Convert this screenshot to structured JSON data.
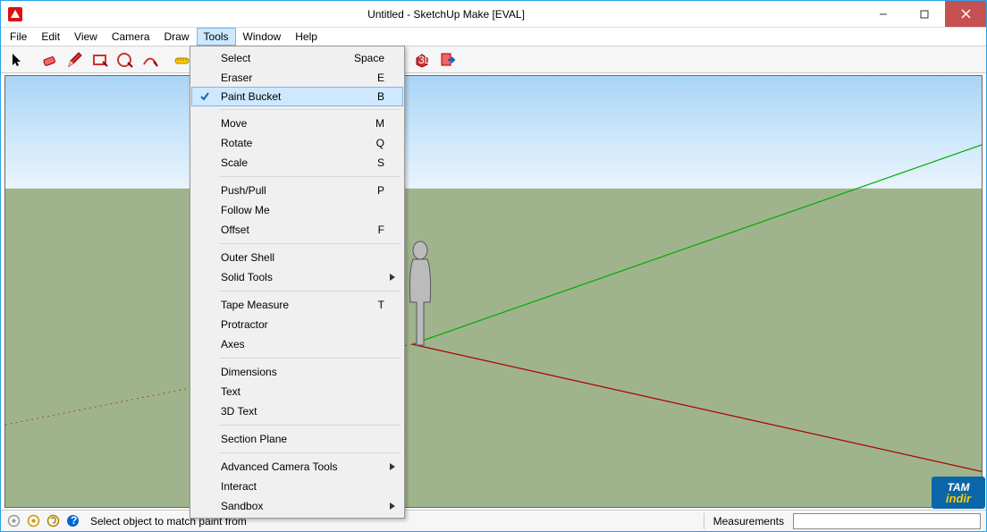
{
  "window": {
    "title": "Untitled - SketchUp Make [EVAL]"
  },
  "menubar": [
    "File",
    "Edit",
    "View",
    "Camera",
    "Draw",
    "Tools",
    "Window",
    "Help"
  ],
  "menubar_open": 5,
  "dropdown": {
    "groups": [
      [
        {
          "label": "Select",
          "shortcut": "Space",
          "checked": false
        },
        {
          "label": "Eraser",
          "shortcut": "E",
          "checked": false
        },
        {
          "label": "Paint Bucket",
          "shortcut": "B",
          "checked": true
        }
      ],
      [
        {
          "label": "Move",
          "shortcut": "M"
        },
        {
          "label": "Rotate",
          "shortcut": "Q"
        },
        {
          "label": "Scale",
          "shortcut": "S"
        }
      ],
      [
        {
          "label": "Push/Pull",
          "shortcut": "P"
        },
        {
          "label": "Follow Me",
          "shortcut": ""
        },
        {
          "label": "Offset",
          "shortcut": "F"
        }
      ],
      [
        {
          "label": "Outer Shell",
          "shortcut": ""
        },
        {
          "label": "Solid Tools",
          "shortcut": "",
          "submenu": true
        }
      ],
      [
        {
          "label": "Tape Measure",
          "shortcut": "T"
        },
        {
          "label": "Protractor",
          "shortcut": ""
        },
        {
          "label": "Axes",
          "shortcut": ""
        }
      ],
      [
        {
          "label": "Dimensions",
          "shortcut": ""
        },
        {
          "label": "Text",
          "shortcut": ""
        },
        {
          "label": "3D Text",
          "shortcut": ""
        }
      ],
      [
        {
          "label": "Section Plane",
          "shortcut": ""
        }
      ],
      [
        {
          "label": "Advanced Camera Tools",
          "shortcut": "",
          "submenu": true
        },
        {
          "label": "Interact",
          "shortcut": ""
        },
        {
          "label": "Sandbox",
          "shortcut": "",
          "submenu": true
        }
      ]
    ]
  },
  "statusbar": {
    "text": "Select object to match paint from",
    "meas_label": "Measurements"
  },
  "watermark": {
    "line1": "TAM",
    "line2": "indir"
  }
}
